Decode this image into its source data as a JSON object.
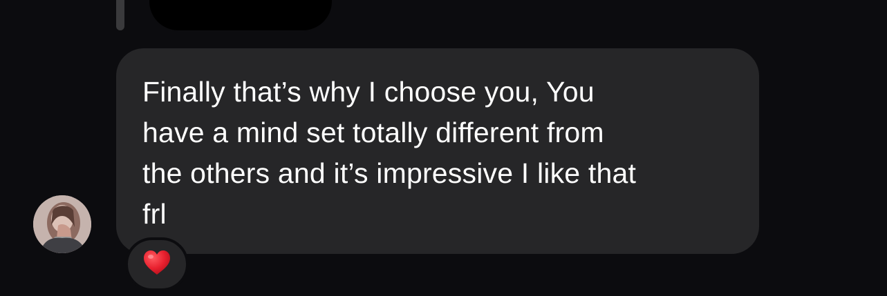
{
  "thread": {
    "quoted_reply": {
      "visible": true
    },
    "message": {
      "text": "Finally that’s why I choose you, You\nhave a mind set totally different from\nthe others and it’s impressive I like that\nfrl",
      "sender": "other"
    },
    "reaction": {
      "icon": "red-heart-icon",
      "color": "#e8202e"
    },
    "avatar": {
      "icon": "profile-photo"
    }
  },
  "colors": {
    "background": "#0c0c0f",
    "bubble": "#262628",
    "text": "#ffffff"
  }
}
